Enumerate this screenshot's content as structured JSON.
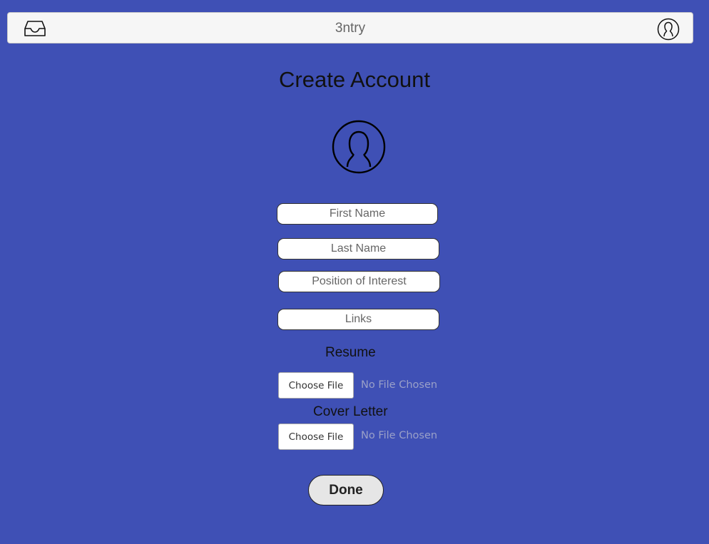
{
  "header": {
    "title": "3ntry",
    "left_icon": "inbox-tray-icon",
    "right_icon": "user-account-icon"
  },
  "main": {
    "title": "Create Account",
    "avatar_icon": "user-avatar-icon",
    "fields": {
      "first_name": {
        "placeholder": "First Name",
        "value": ""
      },
      "last_name": {
        "placeholder": "Last Name",
        "value": ""
      },
      "position": {
        "placeholder": "Position of Interest",
        "value": ""
      },
      "links": {
        "placeholder": "Links",
        "value": ""
      }
    },
    "resume": {
      "label": "Resume",
      "button": "Choose File",
      "status": "No File Chosen"
    },
    "cover_letter": {
      "label": "Cover Letter",
      "button": "Choose File",
      "status": "No File Chosen"
    },
    "done_label": "Done"
  },
  "colors": {
    "background": "#3f50b5",
    "header_bg": "#f6f6f6",
    "done_bg": "#e6e6e6",
    "file_status_text": "#9aa0c8"
  }
}
